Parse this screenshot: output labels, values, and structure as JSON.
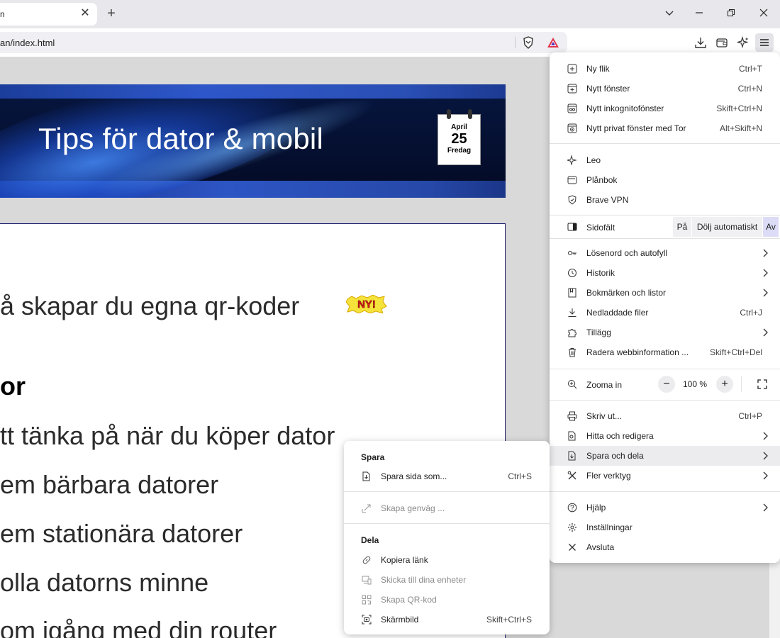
{
  "browser": {
    "tab_title": "n",
    "url": "an/index.html",
    "new_tab_symbol": "+",
    "tab_close_symbol": "✕",
    "window_buttons": {
      "dropdown": "⌄",
      "minimize": "–",
      "restore": "❐",
      "close": "✕"
    }
  },
  "page": {
    "banner_title": "Tips för dator & mobil",
    "calendar": {
      "month": "April",
      "day": "25",
      "weekday": "Fredag"
    },
    "new_badge": "NY!",
    "lines": [
      "å skapar du egna qr-koder",
      "or",
      "tt tänka på när du köper dator",
      "em bärbara datorer",
      "em stationära datorer",
      "olla datorns minne",
      "om igång med din router"
    ]
  },
  "main_menu": {
    "new_tab": {
      "label": "Ny flik",
      "shortcut": "Ctrl+T"
    },
    "new_window": {
      "label": "Nytt fönster",
      "shortcut": "Ctrl+N"
    },
    "incognito": {
      "label": "Nytt inkognitofönster",
      "shortcut": "Skift+Ctrl+N"
    },
    "tor": {
      "label": "Nytt privat fönster med Tor",
      "shortcut": "Alt+Skift+N"
    },
    "leo": {
      "label": "Leo"
    },
    "wallet": {
      "label": "Plånbok"
    },
    "vpn": {
      "label": "Brave VPN"
    },
    "sidebar": {
      "label": "Sidofält",
      "options": [
        "På",
        "Dölj automatiskt",
        "Av"
      ],
      "selected": "Av"
    },
    "passwords": {
      "label": "Lösenord och autofyll"
    },
    "history": {
      "label": "Historik"
    },
    "bookmarks": {
      "label": "Bokmärken och listor"
    },
    "downloads": {
      "label": "Nedladdade filer",
      "shortcut": "Ctrl+J"
    },
    "extensions": {
      "label": "Tillägg"
    },
    "clear_data": {
      "label": "Radera webbinformation ...",
      "shortcut": "Skift+Ctrl+Del"
    },
    "zoom": {
      "label": "Zooma in",
      "minus": "−",
      "value": "100 %",
      "plus": "+"
    },
    "print": {
      "label": "Skriv ut...",
      "shortcut": "Ctrl+P"
    },
    "find_edit": {
      "label": "Hitta och redigera"
    },
    "save_share": {
      "label": "Spara och dela"
    },
    "more_tools": {
      "label": "Fler verktyg"
    },
    "help": {
      "label": "Hjälp"
    },
    "settings": {
      "label": "Inställningar"
    },
    "exit": {
      "label": "Avsluta"
    }
  },
  "submenu": {
    "save_header": "Spara",
    "save_page": {
      "label": "Spara sida som...",
      "shortcut": "Ctrl+S"
    },
    "create_shortcut": {
      "label": "Skapa genväg ..."
    },
    "share_header": "Dela",
    "copy_link": {
      "label": "Kopiera länk"
    },
    "send_devices": {
      "label": "Skicka till dina enheter"
    },
    "qr_code": {
      "label": "Skapa QR-kod"
    },
    "screenshot": {
      "label": "Skärmbild",
      "shortcut": "Skift+Ctrl+S"
    }
  }
}
